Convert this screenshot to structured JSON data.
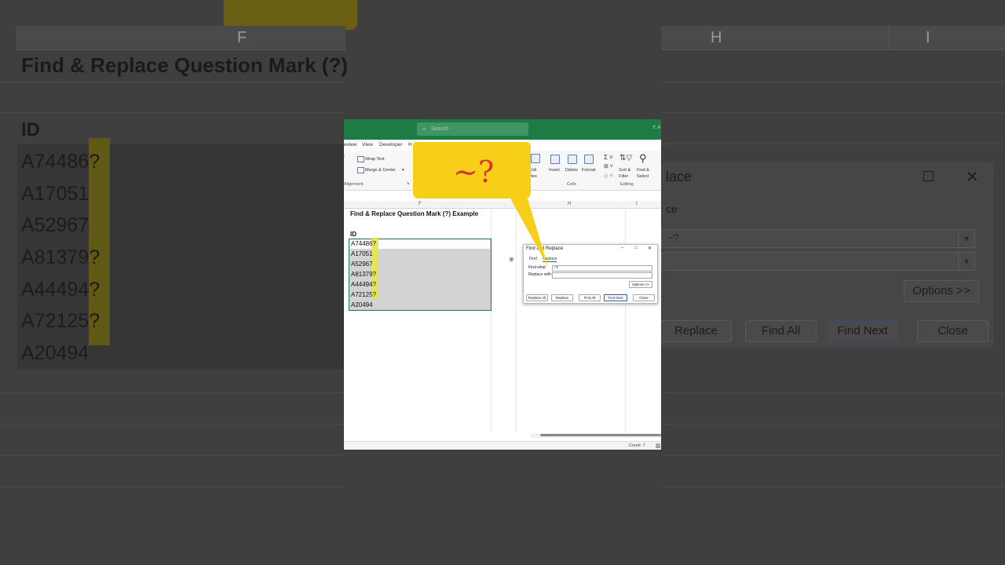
{
  "background": {
    "col_f": "F",
    "col_h": "H",
    "col_i": "I",
    "title": "Find & Replace Question Mark (?)",
    "id_header": "ID",
    "rows": [
      "A74486?",
      "A17051",
      "A52967",
      "A81379?",
      "A44494?",
      "A72125?",
      "A20494"
    ],
    "dialog_title": "lace",
    "dialog_tab": "ce",
    "find_value": "~?",
    "options_label": "Options >>",
    "buttons": [
      "Replace",
      "Find All",
      "Find Next",
      "Close"
    ]
  },
  "excel": {
    "search_placeholder": "Search",
    "account": "Y. A",
    "menu": [
      "eview",
      "View",
      "Developer",
      "H"
    ],
    "ribbon": {
      "wrap_text": "Wrap Text",
      "merge_center": "Merge & Center",
      "alignment_group": "Alignment",
      "cell_styles_1": "Cell",
      "cell_styles_2": "yles",
      "insert": "Insert",
      "delete": "Delete",
      "format": "Format",
      "cells_group": "Cells",
      "sort_filter_1": "Sort &",
      "sort_filter_2": "Filter",
      "find_select_1": "Find &",
      "find_select_2": "Select",
      "editing_group": "Editing"
    },
    "columns": [
      "F",
      "H",
      "I"
    ],
    "sheet_title": "Find & Replace Question Mark (?) Example",
    "id_header": "ID",
    "rows": [
      "A74486?",
      "A17051",
      "A52967",
      "A81379?",
      "A44494?",
      "A72125?",
      "A20494"
    ],
    "status_count": "Count: 7"
  },
  "find_replace": {
    "title": "Find and Replace",
    "tabs": [
      "Find",
      "Replace"
    ],
    "find_label": "Find what:",
    "find_value": "~?",
    "replace_label": "Replace with:",
    "replace_value": "",
    "options_label": "Options >>",
    "buttons": [
      "Replace All",
      "Replace",
      "Find All",
      "Find Next",
      "Close"
    ]
  },
  "callout": {
    "text": "~?",
    "color": "#f7ce18"
  },
  "colors": {
    "excel_green": "#1e7b43",
    "highlight_yellow": "#e8e83a",
    "callout_text": "#d93131"
  }
}
